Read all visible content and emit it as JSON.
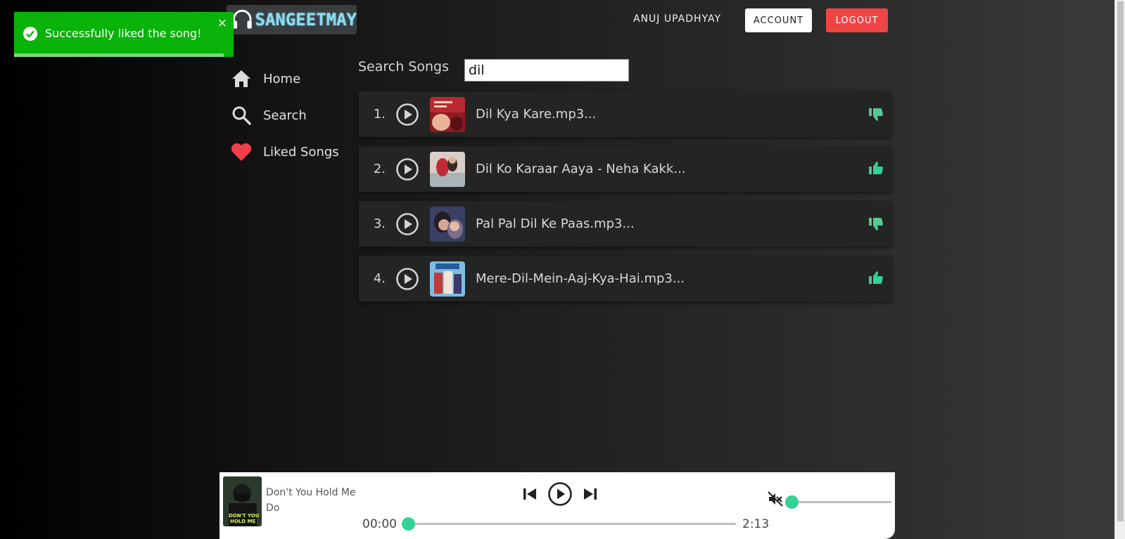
{
  "app": {
    "logo_text": "SANGEETMAY"
  },
  "header": {
    "user_name": "ANUJ UPADHYAY",
    "account_label": "ACCOUNT",
    "logout_label": "LOGOUT"
  },
  "sidebar": {
    "items": [
      {
        "label": "Home",
        "icon": "home-icon"
      },
      {
        "label": "Search",
        "icon": "search-icon"
      },
      {
        "label": "Liked Songs",
        "icon": "heart-icon"
      }
    ]
  },
  "search": {
    "label": "Search Songs",
    "value": "dil"
  },
  "songs": [
    {
      "index": "1.",
      "title": "Dil Kya Kare.mp3...",
      "liked": false,
      "like_icon": "thumbs-down-icon"
    },
    {
      "index": "2.",
      "title": "Dil Ko Karaar Aaya - Neha Kakk...",
      "liked": true,
      "like_icon": "thumbs-up-icon"
    },
    {
      "index": "3.",
      "title": "Pal Pal Dil Ke Paas.mp3...",
      "liked": false,
      "like_icon": "thumbs-down-icon"
    },
    {
      "index": "4.",
      "title": "Mere-Dil-Mein-Aaj-Kya-Hai.mp3...",
      "liked": true,
      "like_icon": "thumbs-up-icon"
    }
  ],
  "toast": {
    "message": "Successfully liked the song!",
    "close_symbol": "×",
    "progress": 0.955
  },
  "player": {
    "title_line1": "Don't You Hold Me",
    "title_line2": "Do",
    "current_time": "00:00",
    "duration": "2:13",
    "progress": 0.0,
    "volume": 0.0,
    "muted": true
  },
  "colors": {
    "accent": "#35d196",
    "like_green": "#35d196",
    "logout_red": "#f04444",
    "toast_green": "#0ab30a",
    "heart_red": "#f0404a"
  }
}
